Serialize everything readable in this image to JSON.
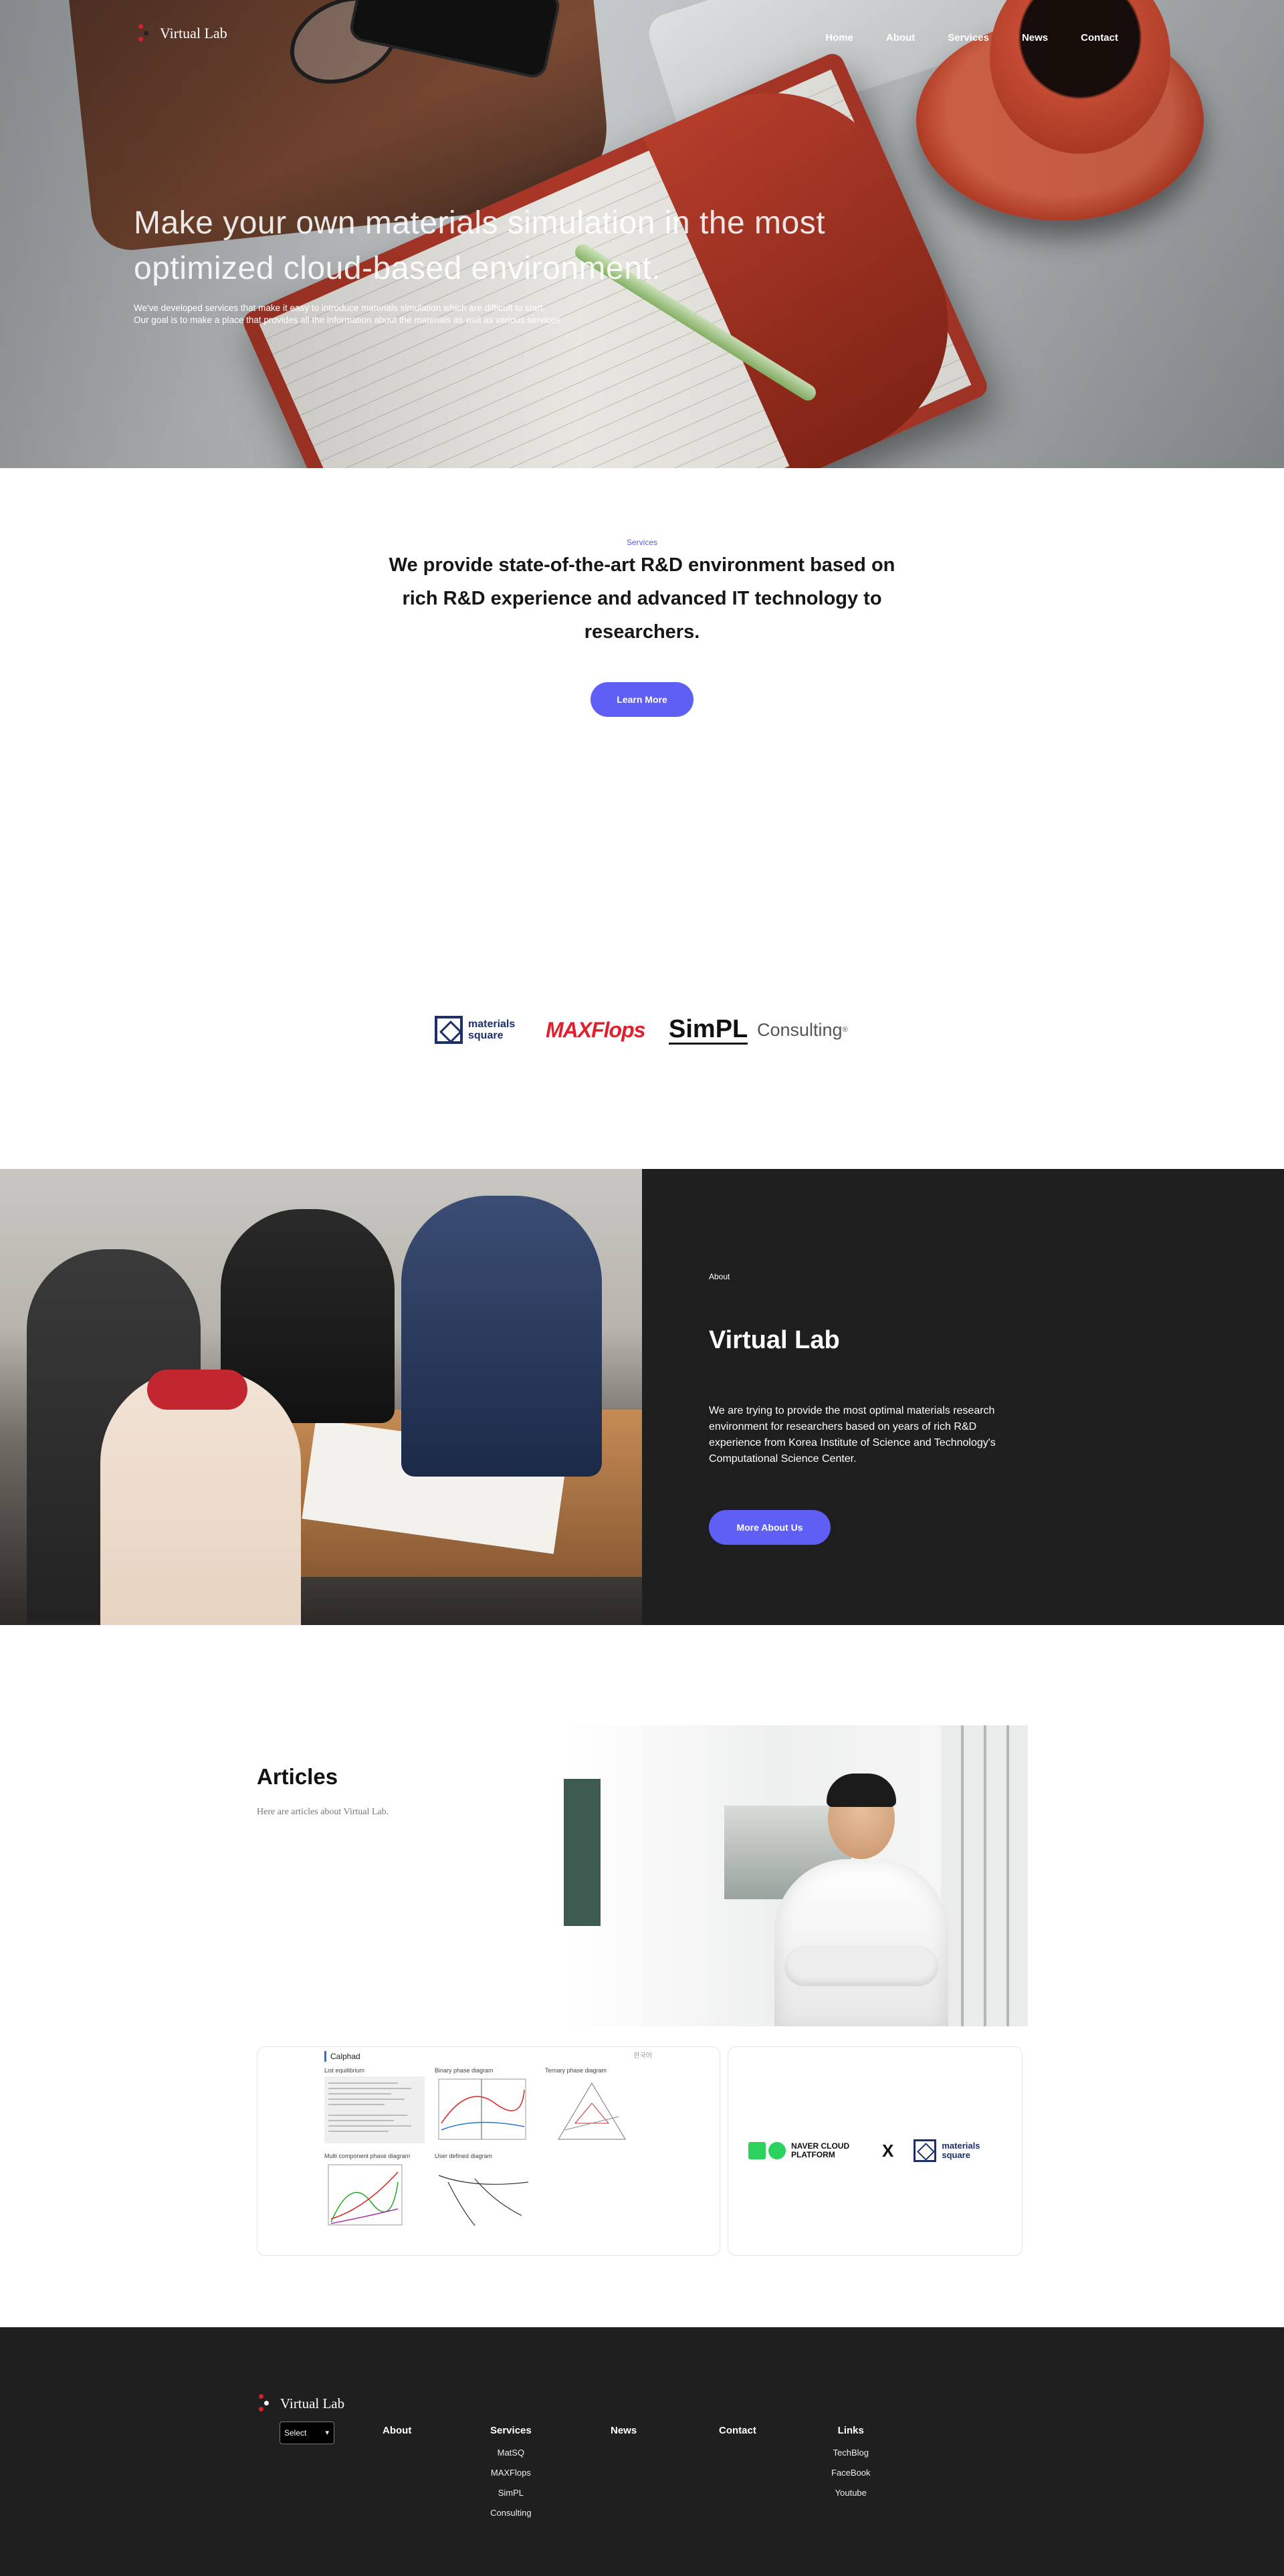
{
  "brand": {
    "name": "Virtual Lab"
  },
  "nav": {
    "items": [
      "Home",
      "About",
      "Services",
      "News",
      "Contact"
    ]
  },
  "hero": {
    "title": "Make your own materials simulation in the most optimized cloud-based environment.",
    "line1": "We've developed services that make it easy to introduce materials simulation which are difficult to start.",
    "line2": "Our goal is to make a place that provides all the information about the materials as well as various services."
  },
  "services": {
    "kicker": "Services",
    "heading": "We provide state-of-the-art R&D environment based on rich R&D experience and advanced IT technology to researchers.",
    "button": "Learn More"
  },
  "partners": {
    "materials_square": "materials square",
    "maxflops": "MAXFlops",
    "simpl": "SimPL",
    "consulting": "Consulting"
  },
  "about": {
    "kicker": "About",
    "title": "Virtual Lab",
    "text": "We are trying to provide the most optimal materials research environment for researchers based on years of rich R&D experience from Korea Institute of Science and Technology's Computational Science Center.",
    "button": "More About Us"
  },
  "articles": {
    "title": "Articles",
    "subtitle": "Here are articles about Virtual Lab.",
    "card1": {
      "header": "Calphad",
      "header_right": "한국어",
      "plots": [
        "List equilibrium",
        "Binary phase diagram",
        "Ternary phase diagram",
        "Multi component phase diagram",
        "User defined diagram"
      ]
    },
    "card2": {
      "naver": "NAVER CLOUD PLATFORM",
      "x": "X",
      "partner": "materials square"
    }
  },
  "footer": {
    "brand": "Virtual Lab",
    "select": "Select",
    "about": "About",
    "services": {
      "title": "Services",
      "links": [
        "MatSQ",
        "MAXFlops",
        "SimPL",
        "Consulting"
      ]
    },
    "news": "News",
    "contact": "Contact",
    "links": {
      "title": "Links",
      "links": [
        "TechBlog",
        "FaceBook",
        "Youtube"
      ]
    }
  },
  "colors": {
    "accent": "#5f5ef5",
    "dark": "#1f1f1f",
    "brand_red": "#d6202e"
  }
}
